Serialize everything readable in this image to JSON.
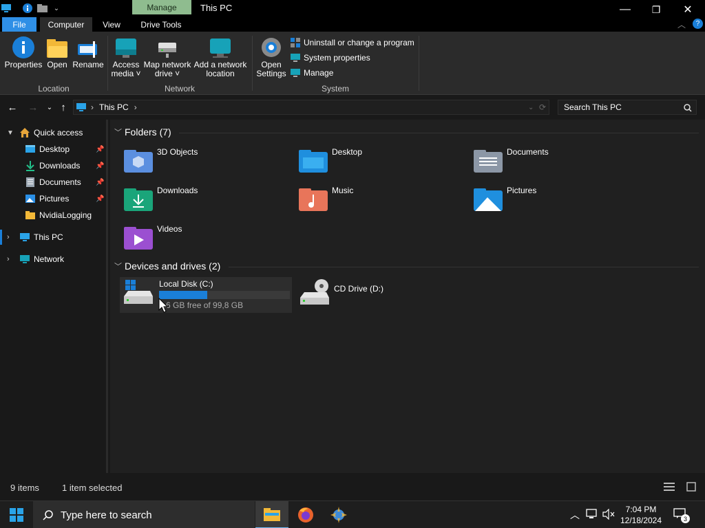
{
  "titlebar": {
    "context_tab": "Manage",
    "title": "This PC",
    "minimize": "—",
    "maximize": "❐",
    "close": "✕"
  },
  "ribbon_tabs": [
    "File",
    "Computer",
    "View",
    "Drive Tools"
  ],
  "ribbon": {
    "location": {
      "label": "Location",
      "buttons": [
        "Properties",
        "Open",
        "Rename"
      ]
    },
    "network": {
      "label": "Network",
      "access_media": [
        "Access",
        "media ˅"
      ],
      "map_drive": [
        "Map network",
        "drive ˅"
      ],
      "add_location": [
        "Add a network",
        "location"
      ]
    },
    "system": {
      "label": "System",
      "open_settings": [
        "Open",
        "Settings"
      ],
      "uninstall": "Uninstall or change a program",
      "system_properties": "System properties",
      "manage": "Manage"
    }
  },
  "address": {
    "crumb": "This PC",
    "sep1": "›",
    "sep2": "›",
    "search_placeholder": "Search This PC"
  },
  "nav": {
    "quick_access": "Quick access",
    "items": [
      "Desktop",
      "Downloads",
      "Documents",
      "Pictures",
      "NvidiaLogging"
    ],
    "this_pc": "This PC",
    "network": "Network"
  },
  "content": {
    "folders_header": "Folders (7)",
    "folders": [
      "3D Objects",
      "Desktop",
      "Documents",
      "Downloads",
      "Music",
      "Pictures",
      "Videos"
    ],
    "drives_header": "Devices and drives (2)",
    "drive_c": {
      "name": "Local Disk (C:)",
      "free": "5.6 GB free of 99,8 GB",
      "used_fraction": 0.37
    },
    "drive_d": {
      "name": "CD Drive (D:)"
    }
  },
  "status": {
    "items": "9 items",
    "selected": "1 item selected"
  },
  "taskbar": {
    "search_placeholder": "Type here to search",
    "time": "7:04 PM",
    "date": "12/18/2024",
    "notif_count": "3"
  },
  "colors": {
    "accent": "#1a7fd8",
    "file_tab": "#2f8fe6",
    "manage_tab": "#8fbc8f"
  }
}
